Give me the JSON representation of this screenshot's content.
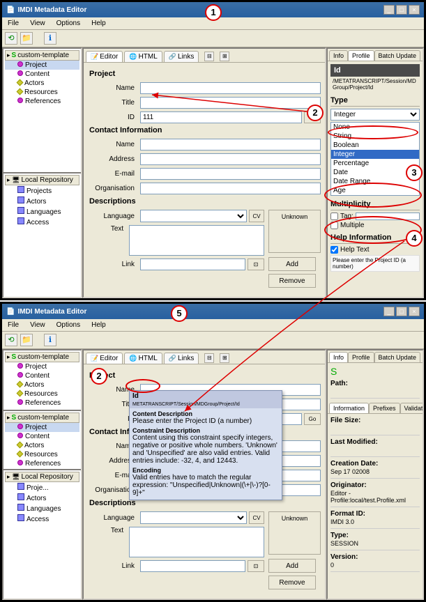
{
  "window_title": "IMDI Metadata Editor",
  "menus": [
    "File",
    "View",
    "Options",
    "Help"
  ],
  "tree": {
    "template_root": "custom-template",
    "template_items": [
      "Project",
      "Content",
      "Actors",
      "Resources",
      "References"
    ],
    "repo_root": "Local Repository",
    "repo_items": [
      "Projects",
      "Actors",
      "Languages",
      "Access"
    ],
    "repo_items_b": [
      "Proje...",
      "Actors",
      "Languages",
      "Access"
    ]
  },
  "center_tabs": [
    "Editor",
    "HTML",
    "Links"
  ],
  "form": {
    "project": "Project",
    "name": "Name",
    "title": "Title",
    "id": "ID",
    "id_value": "111",
    "contact": "Contact Information",
    "contact_name": "Name",
    "address": "Address",
    "email": "E-mail",
    "organisation": "Organisation",
    "descriptions": "Descriptions",
    "language": "Language",
    "text": "Text",
    "link": "Link",
    "unknown": "Unknown",
    "add": "Add",
    "remove": "Remove",
    "cv": "CV",
    "go": "Go"
  },
  "right_tabs": [
    "Info",
    "Profile",
    "Batch Update"
  ],
  "profile": {
    "id_label": "Id",
    "path": "/METATRANSCRIPT/Session/MDGroup/Project/Id",
    "type_label": "Type",
    "types": [
      "None",
      "String",
      "Boolean",
      "Integer",
      "Percentage",
      "Date",
      "Date Range",
      "Age"
    ],
    "selected_type": "Integer",
    "multiplicity": "Multiplicity",
    "tag": "Tag:",
    "multiple": "Multiple",
    "help_label": "Help Information",
    "help_text_chk": "Help Text",
    "help_text": "Please enter the Project ID (a number)"
  },
  "info": {
    "path_label": "Path:",
    "subtabs": [
      "Information",
      "Prefixes",
      "Validation"
    ],
    "file_size": "File Size:",
    "last_modified": "Last Modified:",
    "creation_date": "Creation Date:",
    "creation_date_val": "Sep 17 02008",
    "originator": "Originator:",
    "originator_val": "Editor - Profile:local/test.Profile.xml",
    "format_id": "Format ID:",
    "format_id_val": "IMDI 3.0",
    "type": "Type:",
    "type_val": "SESSION",
    "version": "Version:",
    "version_val": "0"
  },
  "tooltip": {
    "header_path": "METATRANSCRIPT/Session/MDGroup/Project/Id",
    "id": "Id",
    "content_desc": "Content Description",
    "content_text": "Please enter the Project ID (a number)",
    "constraint_desc": "Constraint Description",
    "constraint_text": "Content using this constraint specify integers, negative or positive whole numbers. 'Unknown' and 'Unspecified' are also valid entries. Valid entries include: -32, 4, and 12443.",
    "encoding": "Encoding",
    "encoding_text": "Valid entries have to match the regular expression: \"Unspecified|Unknown|(\\+|\\-)?[0-9]+\""
  },
  "callouts": {
    "1": "1",
    "2": "2",
    "3": "3",
    "4": "4",
    "5": "5"
  }
}
